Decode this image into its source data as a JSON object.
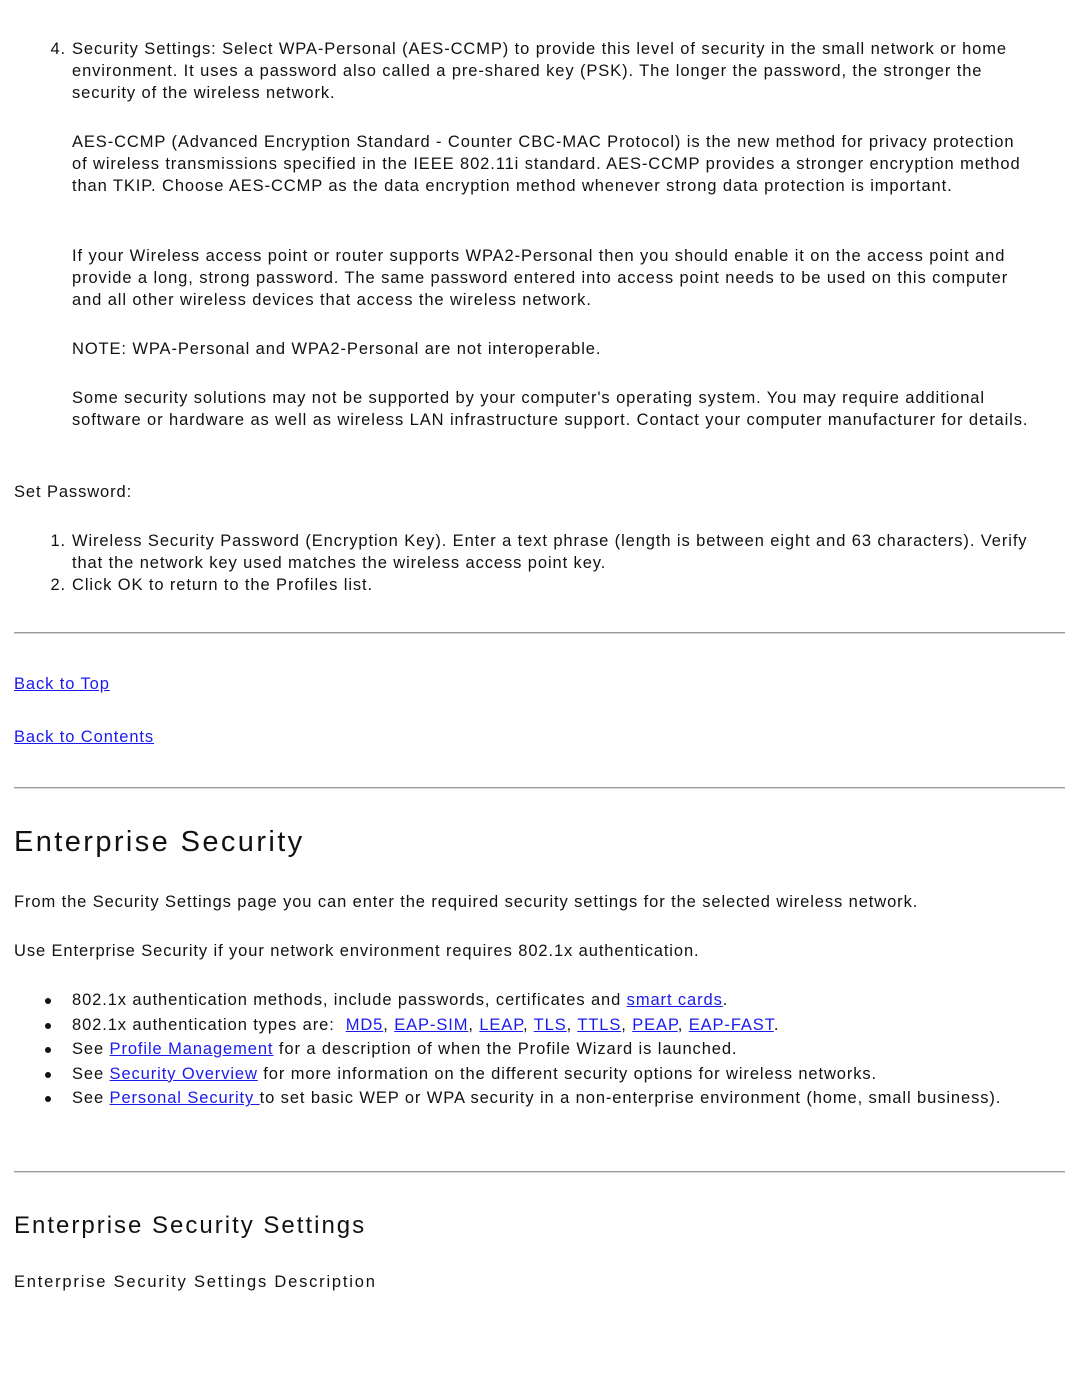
{
  "personal_steps": {
    "item4": {
      "number": "4.",
      "text": "Security Settings: Select WPA-Personal (AES-CCMP) to provide this level of security in the small network or home environment. It uses a password also called a pre-shared key (PSK). The longer the password, the stronger the security of the wireless network."
    },
    "aes_paragraph": "AES-CCMP (Advanced Encryption Standard - Counter CBC-MAC Protocol) is the new method for privacy protection of wireless transmissions specified in the IEEE 802.11i standard. AES-CCMP provides a stronger encryption method than TKIP. Choose AES-CCMP as the data encryption method whenever strong data protection is important.",
    "wpa2_paragraph": "If your Wireless access point or router supports WPA2-Personal then you should enable it on the access point and provide a long, strong password. The same password entered into access point needs to be used on this computer and all other wireless devices that access the wireless network.",
    "note": "NOTE: WPA-Personal and WPA2-Personal are not interoperable.",
    "support_paragraph": "Some security solutions may not be supported by your computer's operating system. You may require additional software or hardware as well as wireless LAN infrastructure support. Contact your computer manufacturer for details."
  },
  "set_password": {
    "label": "Set Password:",
    "steps": [
      {
        "number": "1.",
        "text": "Wireless Security Password (Encryption Key). Enter a text phrase (length is between eight and 63 characters). Verify that the network key used matches the wireless access point key."
      },
      {
        "number": "2.",
        "text": "Click OK to return to the Profiles list."
      }
    ]
  },
  "nav_links": {
    "back_to_top": "Back to Top",
    "back_to_contents": "Back to Contents"
  },
  "enterprise": {
    "title": "Enterprise Security",
    "intro": "From the Security Settings page you can enter the required security settings for the selected wireless network.",
    "use_when": "Use Enterprise Security if your network environment requires 802.1x authentication.",
    "bullets": {
      "b1_prefix": "802.1x authentication methods, include passwords, certificates and ",
      "b1_link": "smart cards",
      "b1_suffix": ".",
      "b2_prefix": "802.1x authentication types are:  ",
      "b2_links": [
        "MD5",
        "EAP-SIM",
        "LEAP",
        "TLS",
        "TTLS",
        "PEAP",
        "EAP-FAST"
      ],
      "sep": ", ",
      "b2_suffix": ".",
      "b3_prefix": "See ",
      "b3_link": "Profile Management",
      "b3_suffix": " for a description of when the Profile Wizard is launched.",
      "b4_prefix": "See ",
      "b4_link": "Security Overview",
      "b4_suffix": " for more information on the different security options for wireless networks.",
      "b5_prefix": "See ",
      "b5_link": "Personal Security ",
      "b5_suffix": "to set basic WEP or WPA security in a non-enterprise environment (home, small business)."
    }
  },
  "settings": {
    "title": "Enterprise Security Settings",
    "description_label": "Enterprise Security Settings Description"
  },
  "colors": {
    "link": "#1a1aee",
    "text": "#111111",
    "rule": "#9a9a9a"
  }
}
